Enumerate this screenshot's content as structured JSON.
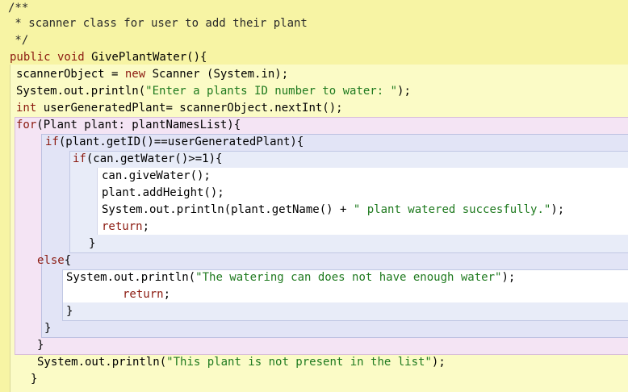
{
  "editor": {
    "lines": [
      {
        "id": "c1",
        "segments": [
          {
            "t": "/**",
            "k": "cm"
          }
        ]
      },
      {
        "id": "c2",
        "segments": [
          {
            "t": " * scanner class for user to add their plant",
            "k": "cm"
          }
        ]
      },
      {
        "id": "c3",
        "segments": [
          {
            "t": " */",
            "k": "cm"
          }
        ]
      },
      {
        "id": "l1",
        "segments": [
          {
            "t": "public void",
            "k": "kw"
          },
          {
            "t": " GivePlantWater(){",
            "k": "txt"
          }
        ]
      },
      {
        "id": "l2",
        "segments": [
          {
            "t": "scannerObject = ",
            "k": "txt"
          },
          {
            "t": "new",
            "k": "kw"
          },
          {
            "t": " Scanner (System.in);",
            "k": "txt"
          }
        ]
      },
      {
        "id": "l3",
        "segments": [
          {
            "t": "System.out.println(",
            "k": "txt"
          },
          {
            "t": "\"Enter a plants ID number to water: \"",
            "k": "str"
          },
          {
            "t": ");",
            "k": "txt"
          }
        ]
      },
      {
        "id": "l4",
        "segments": [
          {
            "t": "int",
            "k": "kw"
          },
          {
            "t": " userGeneratedPlant= scannerObject.nextInt();",
            "k": "txt"
          }
        ]
      },
      {
        "id": "l5",
        "segments": [
          {
            "t": "for",
            "k": "kw"
          },
          {
            "t": "(Plant plant: plantNamesList){",
            "k": "txt"
          }
        ]
      },
      {
        "id": "l6",
        "segments": [
          {
            "t": "if",
            "k": "kw"
          },
          {
            "t": "(plant.getID()==userGeneratedPlant){",
            "k": "txt"
          }
        ]
      },
      {
        "id": "l7",
        "segments": [
          {
            "t": "if",
            "k": "kw"
          },
          {
            "t": "(can.getWater()>=1){",
            "k": "txt"
          }
        ]
      },
      {
        "id": "l8",
        "segments": [
          {
            "t": "can.giveWater();",
            "k": "txt"
          }
        ]
      },
      {
        "id": "l9",
        "segments": [
          {
            "t": "plant.addHeight();",
            "k": "txt"
          }
        ]
      },
      {
        "id": "l10",
        "segments": [
          {
            "t": "System.out.println(plant.getName() + ",
            "k": "txt"
          },
          {
            "t": "\" plant watered succesfully.\"",
            "k": "str"
          },
          {
            "t": ");",
            "k": "txt"
          }
        ]
      },
      {
        "id": "l11",
        "segments": [
          {
            "t": "return",
            "k": "kw"
          },
          {
            "t": ";",
            "k": "txt"
          }
        ]
      },
      {
        "id": "l12",
        "segments": [
          {
            "t": "}",
            "k": "txt"
          }
        ]
      },
      {
        "id": "l13",
        "segments": [
          {
            "t": "else",
            "k": "kw"
          },
          {
            "t": "{",
            "k": "txt"
          }
        ]
      },
      {
        "id": "l14",
        "segments": [
          {
            "t": "System.out.println(",
            "k": "txt"
          },
          {
            "t": "\"The watering can does not have enough water\"",
            "k": "str"
          },
          {
            "t": ");",
            "k": "txt"
          }
        ]
      },
      {
        "id": "l15",
        "segments": [
          {
            "t": "return",
            "k": "kw"
          },
          {
            "t": ";",
            "k": "txt"
          }
        ]
      },
      {
        "id": "l16",
        "segments": [
          {
            "t": "}",
            "k": "txt"
          }
        ]
      },
      {
        "id": "l17",
        "segments": [
          {
            "t": "}",
            "k": "txt"
          }
        ]
      },
      {
        "id": "l18",
        "segments": [
          {
            "t": "}",
            "k": "txt"
          }
        ]
      },
      {
        "id": "l19",
        "segments": [
          {
            "t": "System.out.println(",
            "k": "txt"
          },
          {
            "t": "\"This plant is not present in the list\"",
            "k": "str"
          },
          {
            "t": ");",
            "k": "txt"
          }
        ]
      },
      {
        "id": "l20",
        "segments": [
          {
            "t": "}",
            "k": "txt"
          }
        ]
      }
    ]
  },
  "colors": {
    "background": "#f7f4a4",
    "method_block": "#fbfbc6",
    "loop_block": "#f4e4f4",
    "if_block": "#e2e4f6",
    "keyword": "#8b1a10",
    "string": "#1f7a1f"
  }
}
